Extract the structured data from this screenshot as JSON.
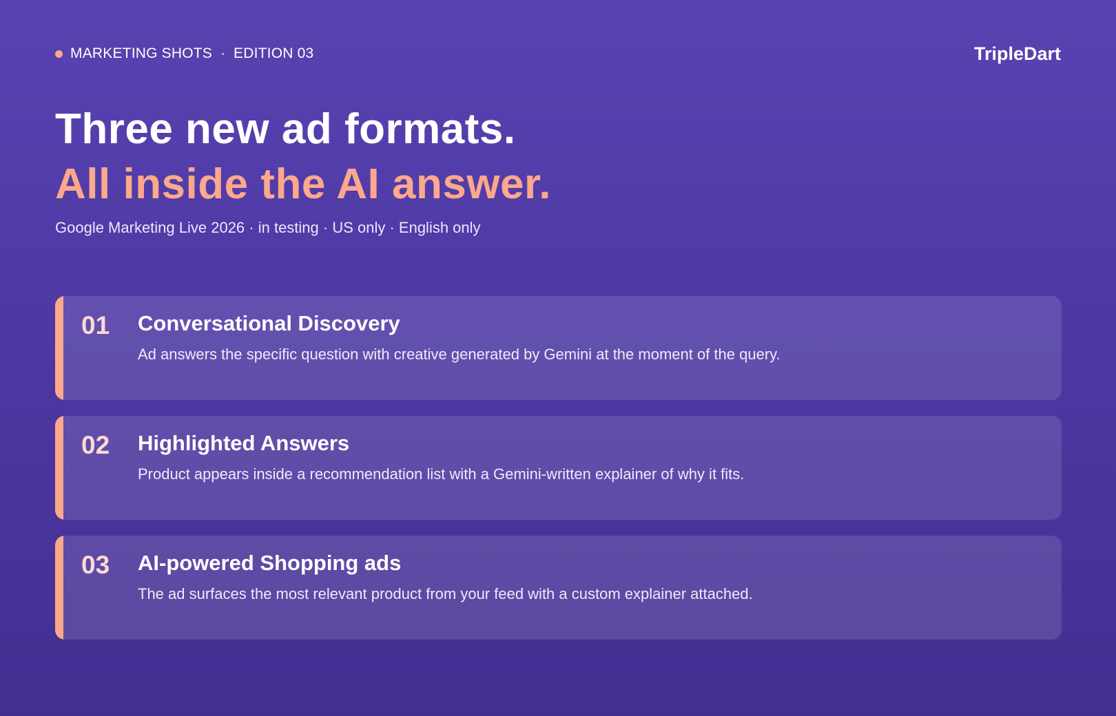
{
  "header": {
    "kicker": "MARKETING SHOTS",
    "separator": "·",
    "edition": "EDITION 03",
    "logo": "TripleDart"
  },
  "headline": {
    "line1": "Three new ad formats.",
    "line2": "All inside the AI answer.",
    "subline": "Google Marketing Live 2026 · in testing · US only · English only"
  },
  "cards": [
    {
      "number": "01",
      "title": "Conversational Discovery",
      "description": "Ad answers the specific question with creative generated by Gemini at the moment of the query."
    },
    {
      "number": "02",
      "title": "Highlighted Answers",
      "description": "Product appears inside a recommendation list with a Gemini-written explainer of why it fits."
    },
    {
      "number": "03",
      "title": "AI-powered Shopping ads",
      "description": "The ad surfaces the most relevant product from your feed with a custom explainer attached."
    }
  ],
  "colors": {
    "accent": "#fba88c",
    "background_top": "#5943b1",
    "background_bottom": "#432f91"
  }
}
